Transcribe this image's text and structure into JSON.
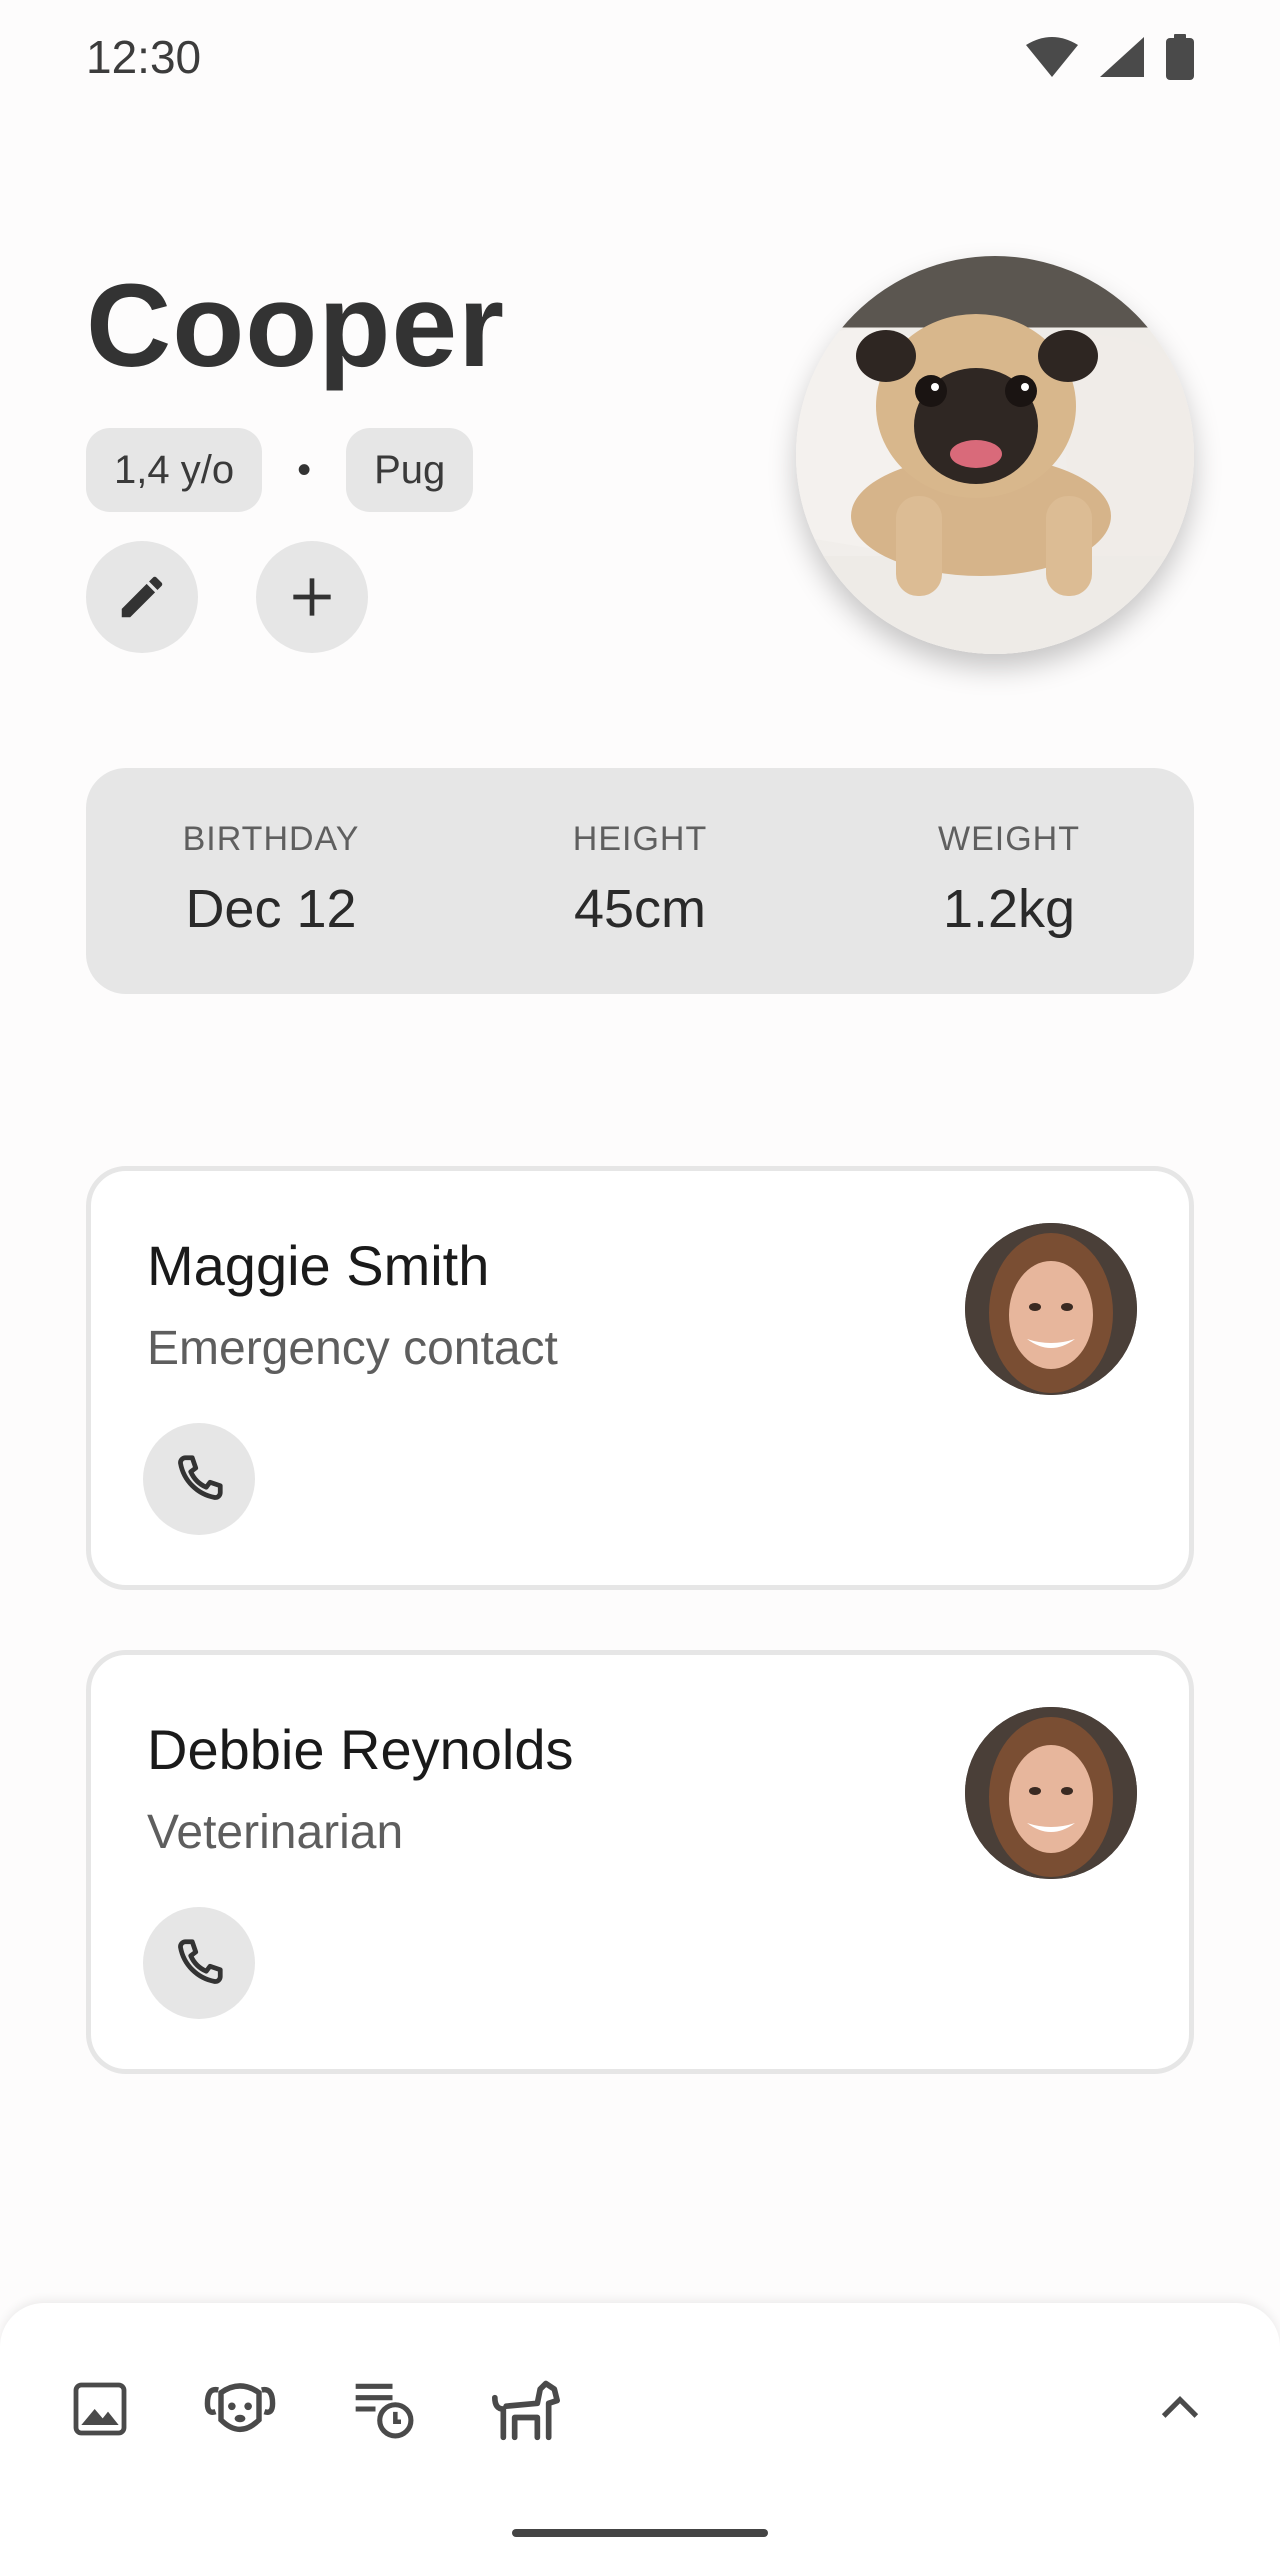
{
  "status_bar": {
    "time": "12:30"
  },
  "pet": {
    "name": "Cooper",
    "age": "1,4 y/o",
    "separator": "•",
    "breed": "Pug"
  },
  "stats": [
    {
      "label": "BIRTHDAY",
      "value": "Dec 12"
    },
    {
      "label": "HEIGHT",
      "value": "45cm"
    },
    {
      "label": "WEIGHT",
      "value": "1.2kg"
    }
  ],
  "contacts": [
    {
      "name": "Maggie Smith",
      "role": "Emergency contact"
    },
    {
      "name": "Debbie Reynolds",
      "role": "Veterinarian"
    }
  ],
  "bottom_nav": {
    "icons": [
      "gallery-icon",
      "dog-face-icon",
      "schedule-list-icon",
      "dog-icon",
      "chevron-up-icon"
    ]
  }
}
